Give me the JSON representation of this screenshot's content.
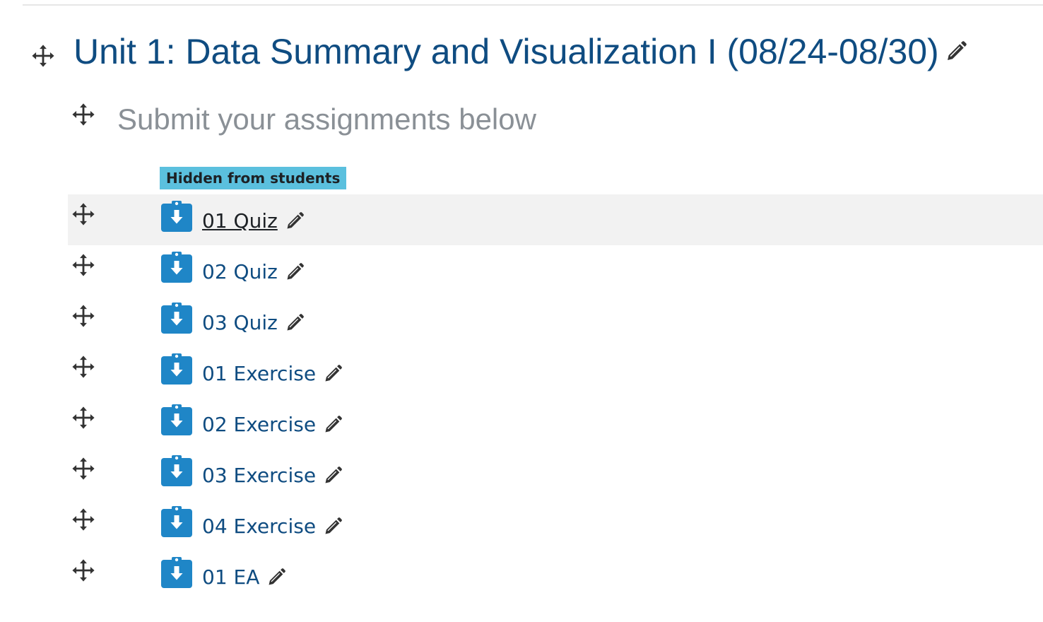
{
  "section": {
    "title": "Unit 1: Data Summary and Visualization I (08/24-08/30)",
    "icons": {
      "move": "move-icon",
      "edit": "pencil-icon"
    }
  },
  "label": {
    "text": "Submit your assignments below"
  },
  "badge": {
    "text": "Hidden from students",
    "color": "#5bc0de"
  },
  "colors": {
    "link": "#0f4c81",
    "assignment_icon": "#1f86c7",
    "row_highlight": "#f2f2f2",
    "muted_text": "#8a9096"
  },
  "activities": [
    {
      "name": "01 Quiz",
      "icon": "assignment-icon",
      "highlighted": true
    },
    {
      "name": "02 Quiz",
      "icon": "assignment-icon"
    },
    {
      "name": "03 Quiz",
      "icon": "assignment-icon"
    },
    {
      "name": "01 Exercise",
      "icon": "assignment-icon"
    },
    {
      "name": "02 Exercise",
      "icon": "assignment-icon"
    },
    {
      "name": "03 Exercise",
      "icon": "assignment-icon"
    },
    {
      "name": "04 Exercise",
      "icon": "assignment-icon"
    },
    {
      "name": "01 EA",
      "icon": "assignment-icon"
    }
  ]
}
